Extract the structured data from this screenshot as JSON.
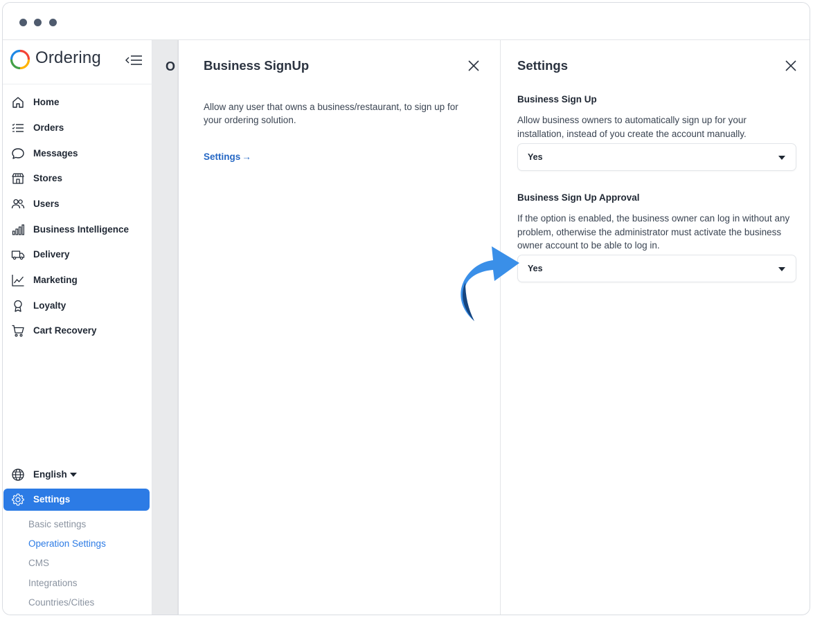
{
  "window": {
    "controls": [
      "dot",
      "dot",
      "dot"
    ]
  },
  "app": {
    "name": "Ordering"
  },
  "sidebar": {
    "items": [
      {
        "label": "Home",
        "icon": "home-icon"
      },
      {
        "label": "Orders",
        "icon": "orders-list-icon"
      },
      {
        "label": "Messages",
        "icon": "chat-bubble-icon"
      },
      {
        "label": "Stores",
        "icon": "store-icon"
      },
      {
        "label": "Users",
        "icon": "users-icon"
      },
      {
        "label": "Business Intelligence",
        "icon": "bar-chart-icon"
      },
      {
        "label": "Delivery",
        "icon": "truck-icon"
      },
      {
        "label": "Marketing",
        "icon": "line-chart-icon"
      },
      {
        "label": "Loyalty",
        "icon": "award-icon"
      },
      {
        "label": "Cart Recovery",
        "icon": "cart-icon"
      }
    ],
    "language": "English",
    "settings_label": "Settings",
    "settings_sub": [
      {
        "label": "Basic settings",
        "active": false
      },
      {
        "label": "Operation Settings",
        "active": true
      },
      {
        "label": "CMS",
        "active": false
      },
      {
        "label": "Integrations",
        "active": false
      },
      {
        "label": "Countries/Cities",
        "active": false
      }
    ]
  },
  "background": {
    "title_fragment": "O"
  },
  "panel_business": {
    "title": "Business SignUp",
    "description": "Allow any user that owns a business/restaurant, to sign up for your ordering solution.",
    "link": "Settings",
    "link_arrow": "→"
  },
  "panel_settings": {
    "title": "Settings",
    "sections": [
      {
        "title": "Business Sign Up",
        "description": "Allow business owners to automatically sign up for your installation, instead of you create the account manually.",
        "value": "Yes"
      },
      {
        "title": "Business Sign Up Approval",
        "description": "If the option is enabled, the business owner can log in without any problem, otherwise the administrator must activate the business owner account to be able to log in.",
        "value": "Yes"
      }
    ]
  },
  "colors": {
    "accent": "#2c7be5",
    "link": "#2567c4",
    "arrow_light": "#3a8fe8",
    "arrow_dark": "#16457f"
  }
}
